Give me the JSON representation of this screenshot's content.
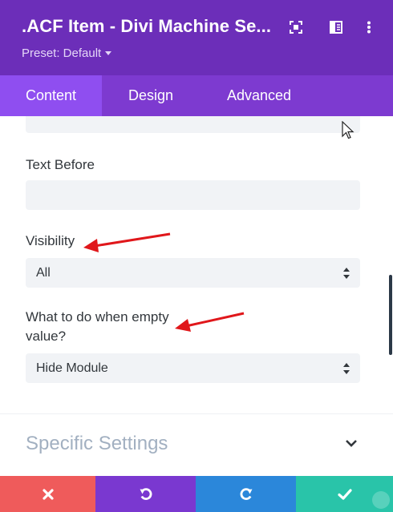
{
  "header": {
    "title": ".ACF Item - Divi Machine Se...",
    "preset": "Preset: Default"
  },
  "tabs": [
    {
      "label": "Content",
      "active": true
    },
    {
      "label": "Design",
      "active": false
    },
    {
      "label": "Advanced",
      "active": false
    }
  ],
  "fields": {
    "text_before": {
      "label": "Text Before",
      "value": ""
    },
    "visibility": {
      "label": "Visibility",
      "value": "All"
    },
    "empty_value": {
      "label_line1": "What to do when empty",
      "label_line2": "value?",
      "value": "Hide Module"
    }
  },
  "section": {
    "title": "Specific Settings"
  },
  "colors": {
    "header_bg": "#6c2eb9",
    "tabs_bg": "#7d3ad0",
    "active_tab_bg": "#8f4ef0",
    "cancel": "#ef5b5b",
    "undo": "#7a38d0",
    "redo": "#2b87da",
    "save": "#29c4a9",
    "annotation_arrow": "#e0171b"
  }
}
